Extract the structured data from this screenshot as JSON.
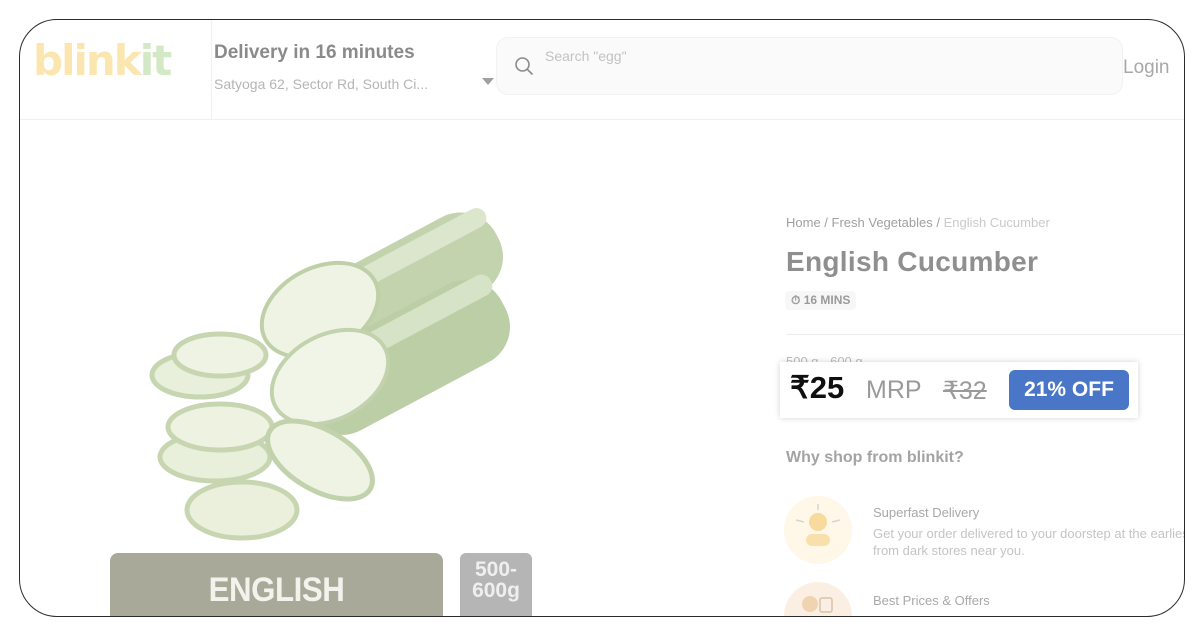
{
  "header": {
    "logo": {
      "part1": "blink",
      "part2": "it"
    },
    "delivery_title": "Delivery in 16 minutes",
    "delivery_address": "Satyoga 62, Sector Rd, South Ci...",
    "search_placeholder": "Search \"egg\"",
    "login_label": "Login"
  },
  "product": {
    "image_label": "ENGLISH CUCUMBER",
    "image_size_label": "500-\n600g",
    "breadcrumb": {
      "home": "Home",
      "sep1": " / ",
      "category": "Fresh Vegetables",
      "sep2": " / ",
      "current": "English Cucumber"
    },
    "title": "English Cucumber",
    "eta": "16 MINS",
    "weight": "500 g - 600 g",
    "price": "₹25",
    "mrp_label": "MRP",
    "mrp_value": "₹32",
    "discount": "21% OFF"
  },
  "why_shop": {
    "heading": "Why shop from blinkit?",
    "features": [
      {
        "title": "Superfast Delivery",
        "desc": "Get your order delivered to your doorstep at the earliest from dark stores near you."
      },
      {
        "title": "Best Prices & Offers"
      }
    ]
  },
  "colors": {
    "discount_badge": "#4a76c7",
    "logo_yellow": "#fbe6b0",
    "logo_green": "#d3e8c5"
  }
}
